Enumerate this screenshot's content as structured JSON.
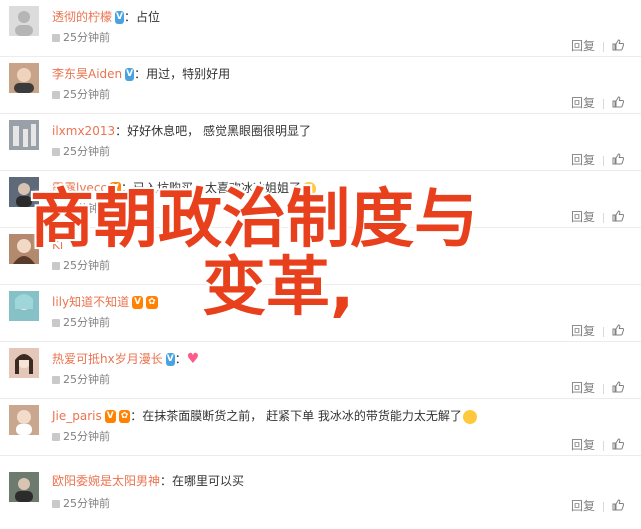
{
  "comments": [
    {
      "user": "透彻的柠檬",
      "badges": [
        "v"
      ],
      "text": "占位",
      "time": "25分钟前",
      "avatar_bg": "#dcdcdc"
    },
    {
      "user": "李东昊Aiden",
      "badges": [
        "v"
      ],
      "text": "用过，特别好用",
      "time": "25分钟前",
      "avatar_bg": "#c7a489"
    },
    {
      "user": "ilxmx2013",
      "badges": [],
      "text": "好好休息吧， 感觉黑眼圈很明显了",
      "time": "25分钟前",
      "avatar_bg": "#9aa0a8"
    },
    {
      "user": "露露lvecc",
      "badges": [
        "vip"
      ],
      "text": "已入坑购买，太喜欢冰冰姐姐了",
      "time": "25分钟前",
      "avatar_bg": "#5e6a7a"
    },
    {
      "user": "Ki",
      "badges": [],
      "text": "",
      "time": "25分钟前",
      "avatar_bg": "#b48a6e"
    },
    {
      "user": "lily知道不知道",
      "badges": [
        "vip",
        "emo"
      ],
      "text": "",
      "time": "25分钟前",
      "avatar_bg": "#86c1c8"
    },
    {
      "user": "热爱可抵hx岁月漫长",
      "badges": [
        "v"
      ],
      "text": "",
      "time": "25分钟前",
      "avatar_bg": "#e4c7b8"
    },
    {
      "user": "Jie_paris",
      "badges": [
        "vip"
      ],
      "text": "在抹茶面膜断货之前， 赶紧下单 我冰冰的带货能力太无解了",
      "time": "25分钟前",
      "avatar_bg": "#c9a78e"
    },
    {
      "user": "欧阳委婉是太阳男神",
      "badges": [],
      "text": "在哪里可以买",
      "time": "25分钟前",
      "avatar_bg": "#6d7a6e"
    }
  ],
  "labels": {
    "reply": "回复"
  },
  "overlay": {
    "line1": "商朝政治制度与",
    "line2": "变革,"
  }
}
